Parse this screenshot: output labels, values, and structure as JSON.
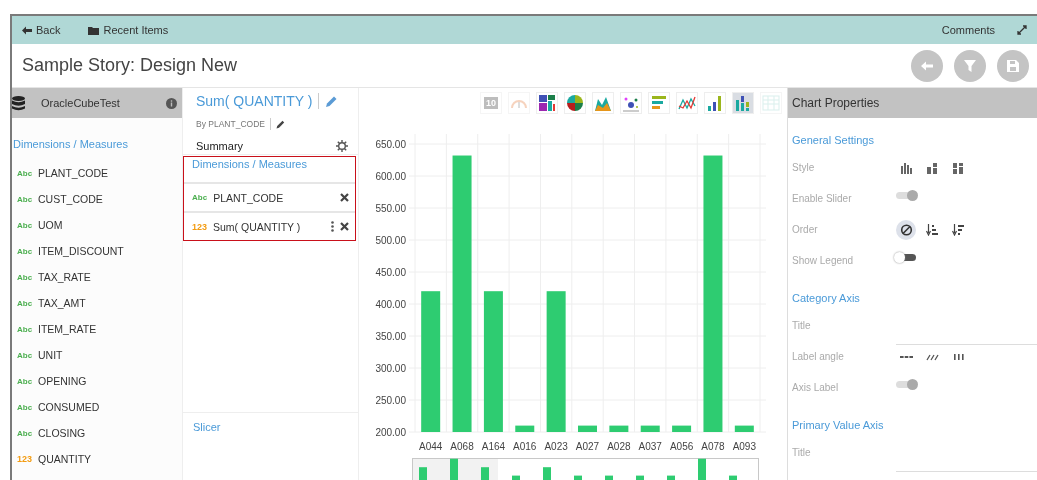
{
  "top_bar": {
    "back": "Back",
    "recent": "Recent Items",
    "comments": "Comments"
  },
  "title": "Sample Story: Design New",
  "source": {
    "name": "OracleCubeTest",
    "section": "Dimensions / Measures",
    "fields": [
      {
        "type": "Abc",
        "kind": "text",
        "name": "PLANT_CODE"
      },
      {
        "type": "Abc",
        "kind": "text",
        "name": "CUST_CODE"
      },
      {
        "type": "Abc",
        "kind": "text",
        "name": "UOM"
      },
      {
        "type": "Abc",
        "kind": "text",
        "name": "ITEM_DISCOUNT"
      },
      {
        "type": "Abc",
        "kind": "text",
        "name": "TAX_RATE"
      },
      {
        "type": "Abc",
        "kind": "text",
        "name": "TAX_AMT"
      },
      {
        "type": "Abc",
        "kind": "text",
        "name": "ITEM_RATE"
      },
      {
        "type": "Abc",
        "kind": "text",
        "name": "UNIT"
      },
      {
        "type": "Abc",
        "kind": "text",
        "name": "OPENING"
      },
      {
        "type": "Abc",
        "kind": "text",
        "name": "CONSUMED"
      },
      {
        "type": "Abc",
        "kind": "text",
        "name": "CLOSING"
      },
      {
        "type": "123",
        "kind": "number",
        "name": "QUANTITY"
      }
    ]
  },
  "widget": {
    "title": "Sum( QUANTITY )",
    "subtitle": "By PLANT_CODE",
    "summary": "Summary",
    "section": "Dimensions / Measures",
    "fields": [
      {
        "type": "Abc",
        "kind": "text",
        "name": "PLANT_CODE",
        "menu": false
      },
      {
        "type": "123",
        "kind": "number",
        "name": "Sum( QUANTITY )",
        "menu": true
      }
    ],
    "slicer": "Slicer"
  },
  "chart_types": [
    {
      "kind": "number",
      "label": "10",
      "selected": false,
      "disabled": true
    },
    {
      "kind": "gauge",
      "selected": false,
      "disabled": true
    },
    {
      "kind": "treemap",
      "selected": false,
      "disabled": false
    },
    {
      "kind": "pie",
      "selected": false,
      "disabled": false
    },
    {
      "kind": "area",
      "selected": false,
      "disabled": false
    },
    {
      "kind": "scatter",
      "selected": false,
      "disabled": false
    },
    {
      "kind": "hbar",
      "selected": false,
      "disabled": false
    },
    {
      "kind": "line",
      "selected": false,
      "disabled": false
    },
    {
      "kind": "bar",
      "selected": false,
      "disabled": false
    },
    {
      "kind": "stacked",
      "selected": true,
      "disabled": false
    },
    {
      "kind": "table",
      "selected": false,
      "disabled": true
    }
  ],
  "chart": {
    "chart_data": {
      "type": "bar",
      "categories": [
        "A044",
        "A068",
        "A164",
        "A016",
        "A023",
        "A027",
        "A028",
        "A037",
        "A056",
        "A078",
        "A093"
      ],
      "grid": true,
      "series": [
        {
          "color": "#2ecc71",
          "values": [
            420,
            632,
            420,
            210,
            420,
            210,
            210,
            210,
            210,
            632,
            210
          ]
        }
      ],
      "ylim": [
        200,
        650
      ],
      "yticks": [
        {
          "value": 200,
          "label": "200.00"
        },
        {
          "value": 250,
          "label": "250.00"
        },
        {
          "value": 300,
          "label": "300.00"
        },
        {
          "value": 350,
          "label": "350.00"
        },
        {
          "value": 400,
          "label": "400.00"
        },
        {
          "value": 450,
          "label": "450.00"
        },
        {
          "value": 500,
          "label": "500.00"
        },
        {
          "value": 550,
          "label": "550.00"
        },
        {
          "value": 600,
          "label": "600.00"
        },
        {
          "value": 650,
          "label": "650.00"
        }
      ]
    }
  },
  "properties": {
    "title": "Chart Properties",
    "sections": [
      {
        "heading": "General Settings",
        "rows": [
          {
            "kind": "icons",
            "label": "Style",
            "options": [
              {
                "kind": "grouped",
                "selected": false
              },
              {
                "kind": "stacked",
                "selected": false
              },
              {
                "kind": "full",
                "selected": false
              }
            ]
          },
          {
            "kind": "toggle",
            "label": "Enable Slider",
            "on": true
          },
          {
            "kind": "icons",
            "label": "Order",
            "options": [
              {
                "kind": "none",
                "selected": true
              },
              {
                "kind": "ascending",
                "selected": false
              },
              {
                "kind": "descending",
                "selected": false
              }
            ]
          },
          {
            "kind": "toggle",
            "label": "Show Legend",
            "on": false
          }
        ]
      },
      {
        "heading": "Category Axis",
        "rows": [
          {
            "kind": "field",
            "label": "Title"
          },
          {
            "kind": "icons",
            "label": "Label angle",
            "options": [
              {
                "kind": "horizontal",
                "selected": false
              },
              {
                "kind": "slanted",
                "selected": false
              },
              {
                "kind": "vertical",
                "selected": false
              }
            ]
          },
          {
            "kind": "toggle",
            "label": "Axis Label",
            "on": true
          }
        ]
      },
      {
        "heading": "Primary Value Axis",
        "rows": [
          {
            "kind": "field",
            "label": "Title"
          }
        ]
      }
    ]
  }
}
